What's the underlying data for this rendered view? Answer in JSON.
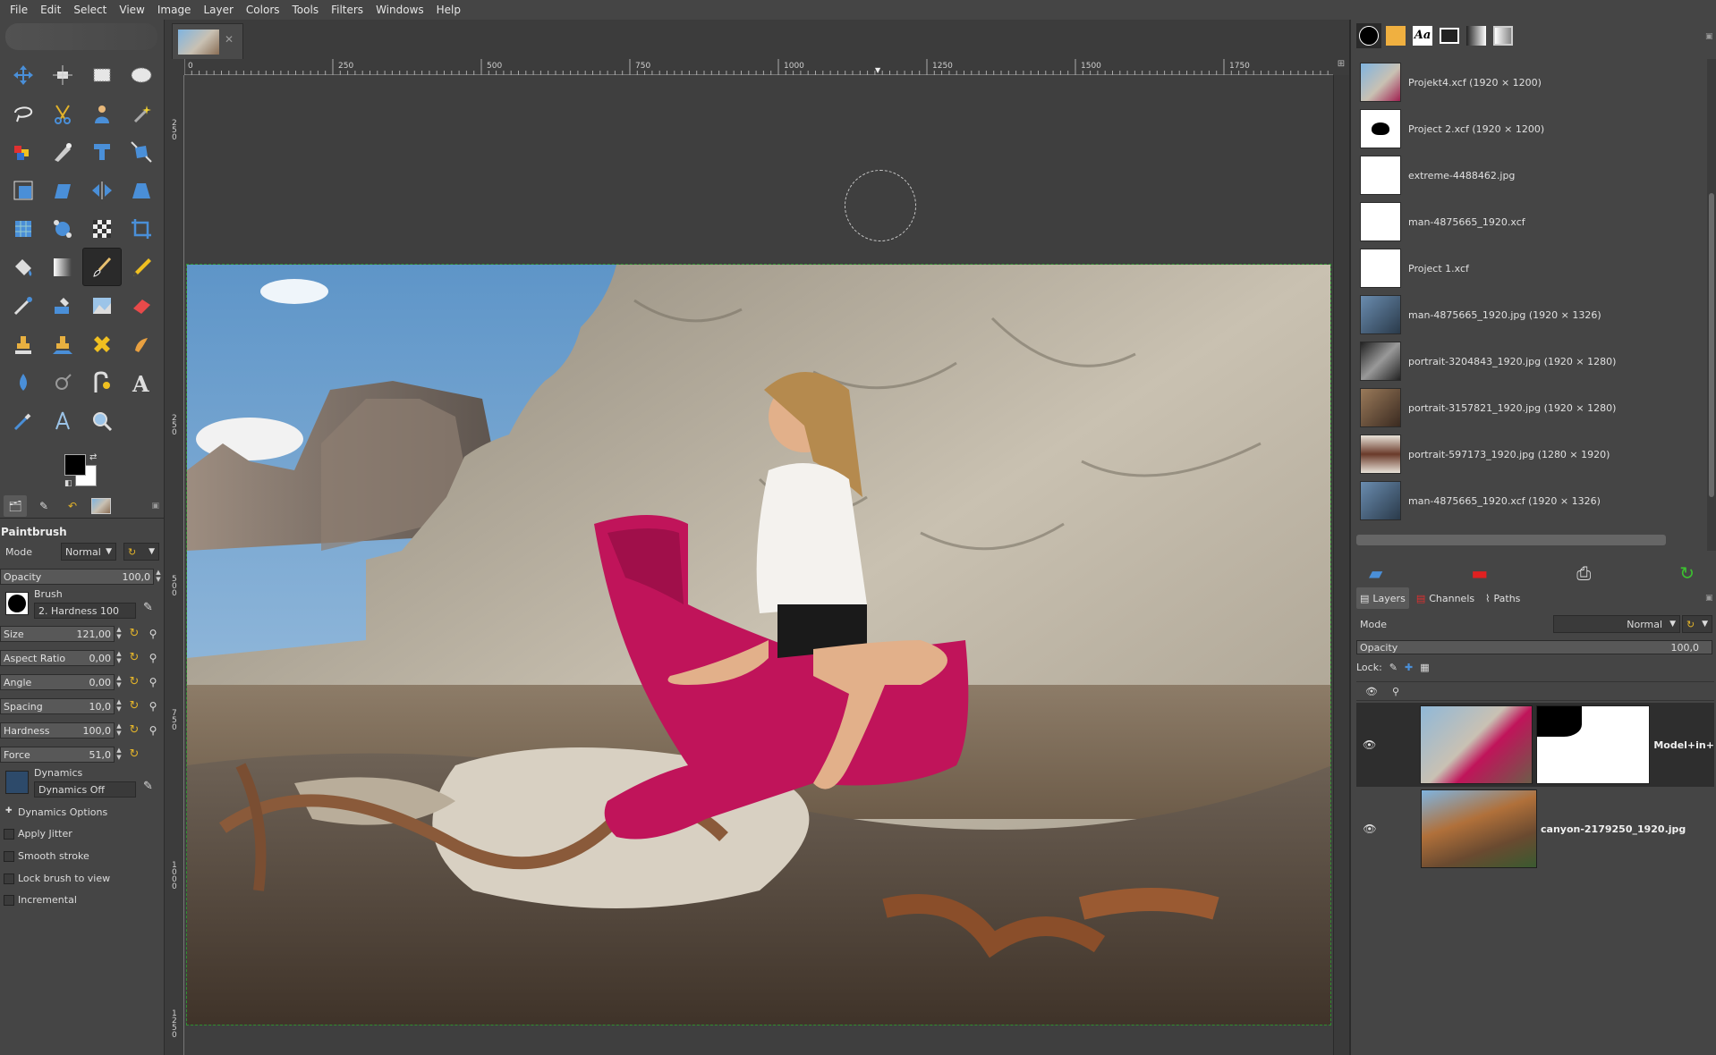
{
  "menubar": [
    "File",
    "Edit",
    "Select",
    "View",
    "Image",
    "Layer",
    "Colors",
    "Tools",
    "Filters",
    "Windows",
    "Help"
  ],
  "tool_options": {
    "title": "Paintbrush",
    "mode_label": "Mode",
    "mode_value": "Normal",
    "opacity_label": "Opacity",
    "opacity_value": "100,0",
    "brush_label": "Brush",
    "brush_value": "2. Hardness 100",
    "size_label": "Size",
    "size_value": "121,00",
    "aspect_label": "Aspect Ratio",
    "aspect_value": "0,00",
    "angle_label": "Angle",
    "angle_value": "0,00",
    "spacing_label": "Spacing",
    "spacing_value": "10,0",
    "hardness_label": "Hardness",
    "hardness_value": "100,0",
    "force_label": "Force",
    "force_value": "51,0",
    "dynamics_label": "Dynamics",
    "dynamics_value": "Dynamics Off",
    "dynamics_options": "Dynamics Options",
    "apply_jitter": "Apply Jitter",
    "smooth_stroke": "Smooth stroke",
    "lock_brush": "Lock brush to view",
    "incremental": "Incremental"
  },
  "ruler": {
    "top": [
      "0",
      "250",
      "500",
      "750",
      "1000",
      "1250",
      "1500",
      "1750"
    ],
    "left": [
      "2 5 0",
      "2 5 0",
      "5 0 0",
      "7 5 0",
      "1 0 0 0",
      "1 2 5 0"
    ]
  },
  "images_list": [
    {
      "name": "Projekt4.xcf (1920 × 1200)"
    },
    {
      "name": "Project 2.xcf (1920 × 1200)"
    },
    {
      "name": "extreme-4488462.jpg"
    },
    {
      "name": "man-4875665_1920.xcf"
    },
    {
      "name": "Project 1.xcf"
    },
    {
      "name": "man-4875665_1920.jpg (1920 × 1326)"
    },
    {
      "name": "portrait-3204843_1920.jpg (1920 × 1280)"
    },
    {
      "name": "portrait-3157821_1920.jpg (1920 × 1280)"
    },
    {
      "name": "portrait-597173_1920.jpg (1280 × 1920)"
    },
    {
      "name": "man-4875665_1920.xcf (1920 × 1326)"
    }
  ],
  "layers_panel": {
    "tabs": [
      "Layers",
      "Channels",
      "Paths"
    ],
    "mode_label": "Mode",
    "mode_value": "Normal",
    "opacity_label": "Opacity",
    "opacity_value": "100,0",
    "lock_label": "Lock:",
    "layers": [
      {
        "name": "Model+in+"
      },
      {
        "name": "canyon-2179250_1920.jpg"
      }
    ]
  },
  "colors": {
    "accent": "#e2b32a",
    "selection": "#2f8f2f",
    "chair": "#c0145a"
  }
}
